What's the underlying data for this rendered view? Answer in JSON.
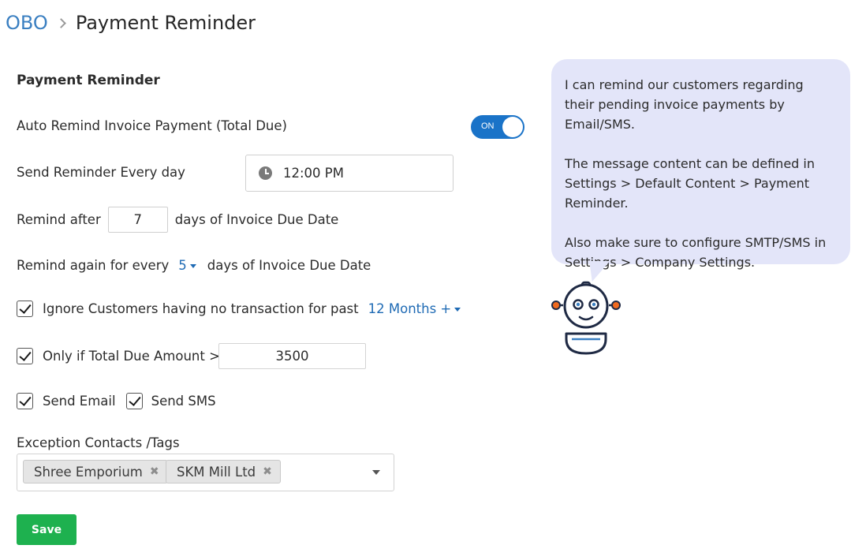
{
  "breadcrumb": {
    "root": "OBO",
    "current": "Payment Reminder"
  },
  "section_title": "Payment Reminder",
  "auto_remind": {
    "label": "Auto Remind Invoice Payment (Total Due)",
    "toggle_text": "ON",
    "enabled": true
  },
  "send_every": {
    "label": "Send Reminder Every day",
    "time": "12:00 PM"
  },
  "remind_after": {
    "prefix": "Remind after",
    "value": "7",
    "suffix": "days of Invoice Due Date"
  },
  "remind_again": {
    "prefix": "Remind again for every",
    "value": "5",
    "suffix": "days of Invoice Due Date"
  },
  "ignore_customers": {
    "label": "Ignore Customers having no transaction for past",
    "value": "12 Months +",
    "checked": true
  },
  "total_due": {
    "label": "Only if Total Due Amount >=",
    "value": "3500",
    "checked": true
  },
  "send_email": {
    "label": "Send Email",
    "checked": true
  },
  "send_sms": {
    "label": "Send SMS",
    "checked": true
  },
  "exceptions": {
    "label": "Exception Contacts /Tags",
    "tags": [
      "Shree Emporium",
      "SKM Mill Ltd"
    ]
  },
  "save_label": "Save",
  "assistant": {
    "p1": "I can remind our customers regarding their pending invoice payments by Email/SMS.",
    "p2": "The message content can be defined in Settings > Default Content > Payment Reminder.",
    "p3": "Also make sure to configure SMTP/SMS in Settings > Company Settings."
  },
  "colors": {
    "accent": "#1a73c8",
    "link": "#3a7fc1",
    "save": "#1eb14f",
    "bubble": "#e3e5f9",
    "robot_stroke": "#1f2a44",
    "robot_ears": "#f06a1f"
  }
}
